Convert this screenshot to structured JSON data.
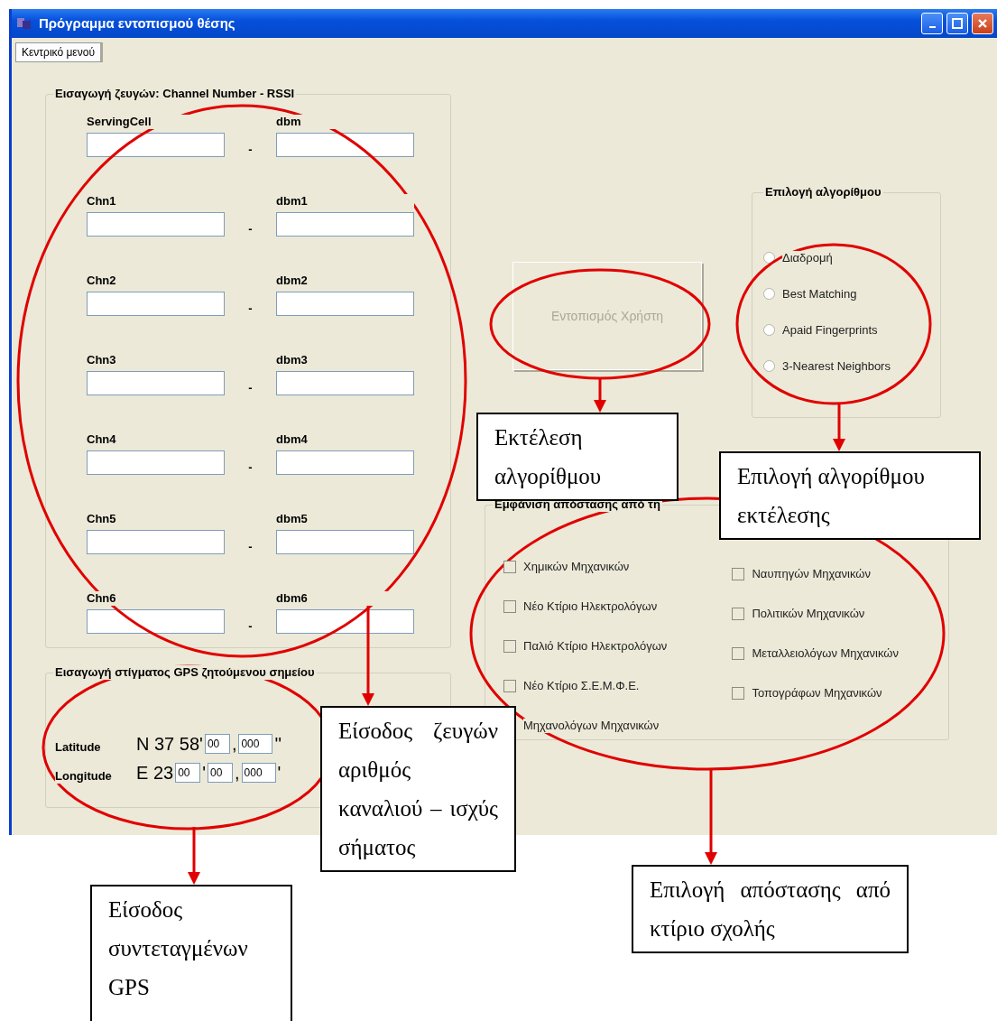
{
  "window": {
    "title": "Πρόγραμμα εντοπισμού θέσης"
  },
  "tabs": [
    {
      "label": "Κεντρικό μενού",
      "selected": true
    }
  ],
  "channel_group": {
    "title": "Εισαγωγή ζευγών: Channel Number - RSSI",
    "pairs": [
      {
        "channel_label": "ServingCell",
        "dbm_label": "dbm",
        "separator": "-"
      },
      {
        "channel_label": "Chn1",
        "dbm_label": "dbm1",
        "separator": "-"
      },
      {
        "channel_label": "Chn2",
        "dbm_label": "dbm2",
        "separator": "-"
      },
      {
        "channel_label": "Chn3",
        "dbm_label": "dbm3",
        "separator": "-"
      },
      {
        "channel_label": "Chn4",
        "dbm_label": "dbm4",
        "separator": "-"
      },
      {
        "channel_label": "Chn5",
        "dbm_label": "dbm5",
        "separator": "-"
      },
      {
        "channel_label": "Chn6",
        "dbm_label": "dbm6",
        "separator": "-"
      }
    ]
  },
  "gps_group": {
    "title": "Εισαγωγή στίγματος GPS ζητούμενου σημείου",
    "rows": [
      {
        "label": "Latitude",
        "parts": [
          {
            "kind": "text",
            "text": "N 37 58'"
          },
          {
            "kind": "field",
            "value": "00"
          },
          {
            "kind": "text",
            "text": ","
          },
          {
            "kind": "field",
            "value": "000"
          },
          {
            "kind": "text",
            "text": "''"
          }
        ]
      },
      {
        "label": "Longitude",
        "parts": [
          {
            "kind": "text",
            "text": "E 23"
          },
          {
            "kind": "field",
            "value": "00"
          },
          {
            "kind": "text",
            "text": "'"
          },
          {
            "kind": "field",
            "value": "00"
          },
          {
            "kind": "text",
            "text": ","
          },
          {
            "kind": "field",
            "value": "000"
          },
          {
            "kind": "text",
            "text": "'"
          }
        ]
      }
    ]
  },
  "locate_button": {
    "label": "Εντοπισμός Χρήστη",
    "disabled": true
  },
  "algorithm_group": {
    "title": "Επιλογή αλγορίθμου",
    "options": [
      {
        "label": "Διαδρομή",
        "selected": false
      },
      {
        "label": "Best Matching",
        "selected": false
      },
      {
        "label": "Apaid Fingerprints",
        "selected": false
      },
      {
        "label": "3-Nearest Neighbors",
        "selected": false
      }
    ]
  },
  "distance_group": {
    "title": "Εμφάνιση απόστασης από τη",
    "columns": [
      [
        {
          "label": "Χημικών Μηχανικών",
          "checked": false
        },
        {
          "label": "Νέο Κτίριο Ηλεκτρολόγων",
          "checked": false
        },
        {
          "label": "Παλιό Κτίριο Ηλεκτρολόγων",
          "checked": false
        },
        {
          "label": "Νέο Κτίριο Σ.Ε.Μ.Φ.Ε.",
          "checked": false
        },
        {
          "label": "Μηχανολόγων Μηχανικών"
        }
      ],
      [
        {
          "label": "Ναυπηγών Μηχανικών",
          "checked": false
        },
        {
          "label": "Πολιτικών Μηχανικών",
          "checked": false
        },
        {
          "label": "Μεταλλειολόγων Μηχανικών",
          "checked": false
        },
        {
          "label": "Τοπογράφων Μηχανικών",
          "checked": false
        }
      ]
    ]
  },
  "annotations": [
    {
      "text": "Εκτέλεση αλγορίθμου"
    },
    {
      "text": "Επιλογή αλγορίθμου εκτέλεσης"
    },
    {
      "text": "Είσοδος ζευγών αριθμός καναλιού – ισχύς σήματος"
    },
    {
      "text": "Είσοδος συντεταγμένων GPS"
    },
    {
      "text": "Επιλογή απόστασης από κτίριο σχολής"
    }
  ]
}
